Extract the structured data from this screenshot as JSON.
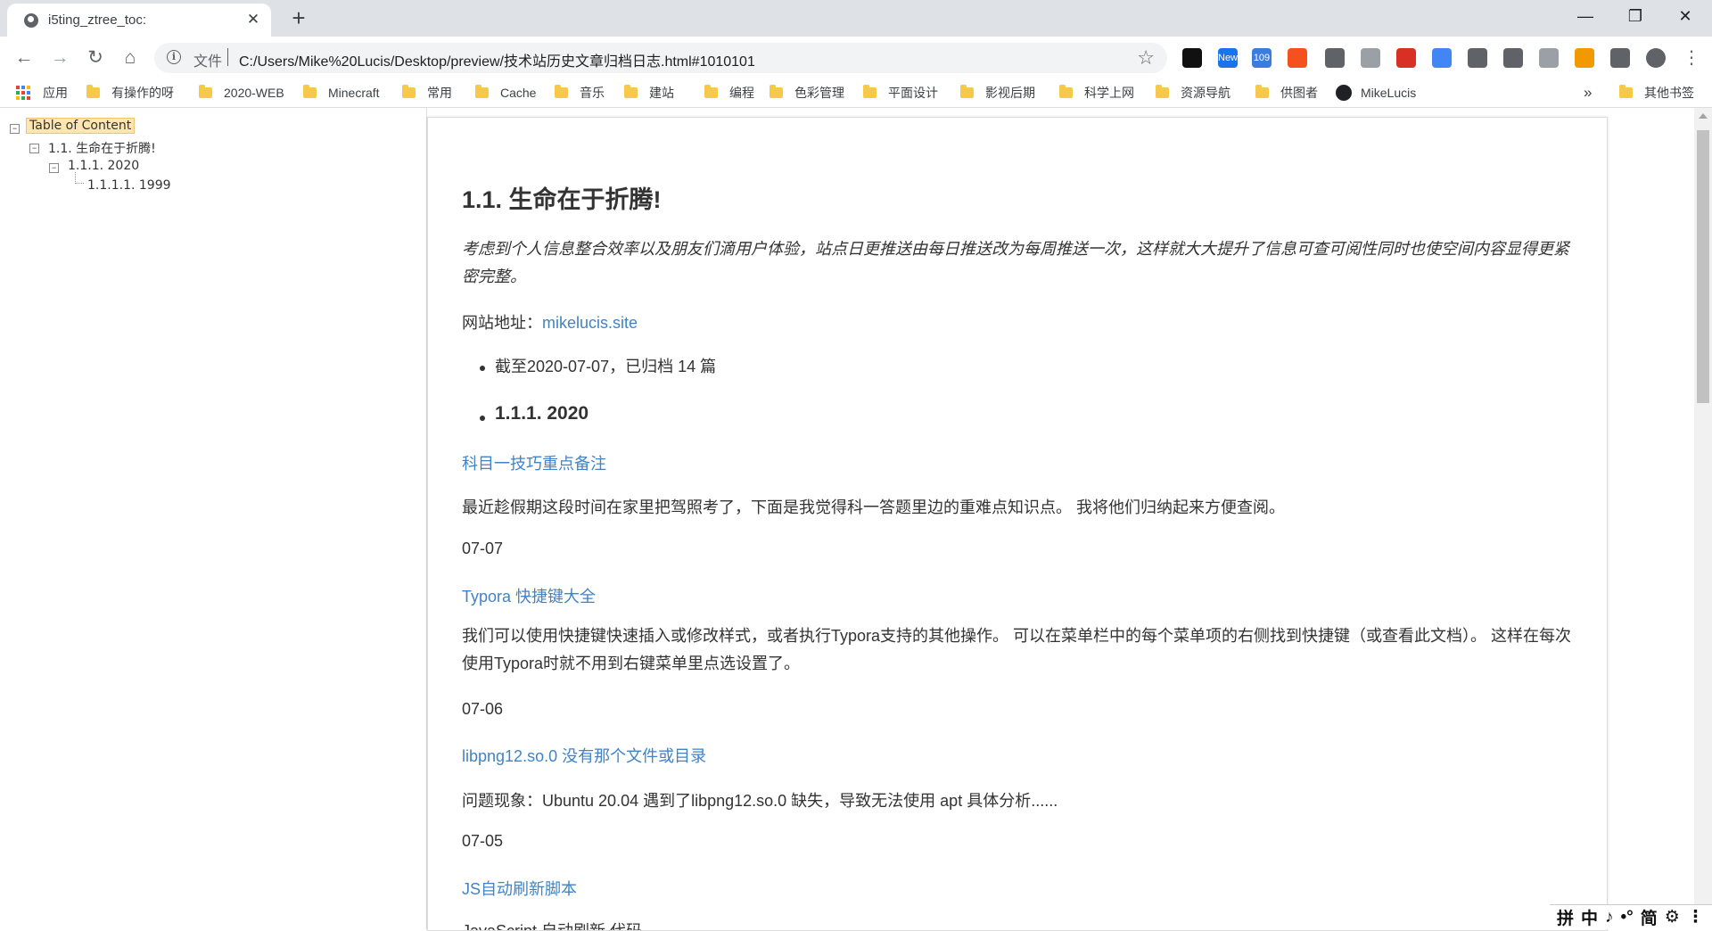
{
  "tab": {
    "title": "i5ting_ztree_toc:",
    "close": "✕",
    "new_tab": "+"
  },
  "window": {
    "minimize": "—",
    "restore": "❐",
    "close": "✕"
  },
  "toolbar": {
    "back": "←",
    "forward": "→",
    "reload": "↻",
    "home": "⌂"
  },
  "omnibox": {
    "scheme": "文件",
    "url": "C:/Users/Mike%20Lucis/Desktop/preview/技术站历史文章归档日志.html#1010101",
    "info": "i",
    "star": "☆"
  },
  "extensions": [
    {
      "name": "tampermonkey-icon",
      "color": "#111111",
      "label": ""
    },
    {
      "name": "new-extension-icon",
      "color": "#1a73e8",
      "label": "New"
    },
    {
      "name": "mail-109-icon",
      "color": "#3b7ddd",
      "label": "109"
    },
    {
      "name": "orange-extension-icon",
      "color": "#f4511e",
      "label": ""
    },
    {
      "name": "eraser-icon",
      "color": "#5f6368",
      "label": ""
    },
    {
      "name": "grid-extension-icon",
      "color": "#9aa0a6",
      "label": ""
    },
    {
      "name": "blocker-icon",
      "color": "#d93025",
      "label": ""
    },
    {
      "name": "translate-icon",
      "color": "#4285f4",
      "label": ""
    },
    {
      "name": "bookmark-icon",
      "color": "#5f6368",
      "label": ""
    },
    {
      "name": "screenshot-icon",
      "color": "#5f6368",
      "label": ""
    },
    {
      "name": "pdf-icon",
      "color": "#9aa0a6",
      "label": ""
    },
    {
      "name": "orange-tool-icon",
      "color": "#f29900",
      "label": ""
    },
    {
      "name": "puzzle-icon",
      "color": "#5f6368",
      "label": ""
    },
    {
      "name": "profile-avatar-icon",
      "color": "#5f6368",
      "label": ""
    },
    {
      "name": "menu-icon",
      "color": "#5f6368",
      "label": "⋮"
    }
  ],
  "bookmarks": {
    "apps": "应用",
    "items": [
      "有操作的呀",
      "2020-WEB",
      "Minecraft",
      "常用",
      "Cache",
      "音乐",
      "建站",
      "编程",
      "色彩管理",
      "平面设计",
      "影视后期",
      "科学上网",
      "资源导航",
      "供图者"
    ],
    "github": "MikeLucis",
    "more": "»",
    "other": "其他书签"
  },
  "toc": {
    "root": "Table of Content",
    "level1": "1.1.   生命在于折腾!",
    "level2": "1.1.1. 2020",
    "level3": "1.1.1.1. 1999"
  },
  "content": {
    "heading": "1.1.   生命在于折腾!",
    "intro": "考虑到个人信息整合效率以及朋友们滴用户体验，站点日更推送由每日推送改为每周推送一次，这样就大大提升了信息可查可阅性同时也使空间内容显得更紧密完整。",
    "site_label": "网站地址：",
    "site_link": "mikelucis.site",
    "archive_note": "截至2020-07-07，已归档 14 篇",
    "year_heading": "1.1.1. 2020",
    "posts": [
      {
        "title": "科目一技巧重点备注",
        "summary": "最近趁假期这段时间在家里把驾照考了，下面是我觉得科一答题里边的重难点知识点。 我将他们归纳起来方便查阅。",
        "date": "07-07"
      },
      {
        "title": "Typora 快捷键大全",
        "summary": "我们可以使用快捷键快速插入或修改样式，或者执行Typora支持的其他操作。 可以在菜单栏中的每个菜单项的右侧找到快捷键（或查看此文档）。 这样在每次使用Typora时就不用到右键菜单里点选设置了。",
        "date": "07-06"
      },
      {
        "title": "libpng12.so.0 没有那个文件或目录",
        "summary": "问题现象：Ubuntu 20.04 遇到了libpng12.so.0 缺失，导致无法使用 apt 具体分析......",
        "date": "07-05"
      },
      {
        "title": "JS自动刷新脚本",
        "summary": "JavaScript 自动刷新 代码",
        "date": ""
      }
    ]
  },
  "ime": [
    "拼",
    "中",
    "♪",
    "•°",
    "简",
    "⚙",
    "⋮"
  ]
}
